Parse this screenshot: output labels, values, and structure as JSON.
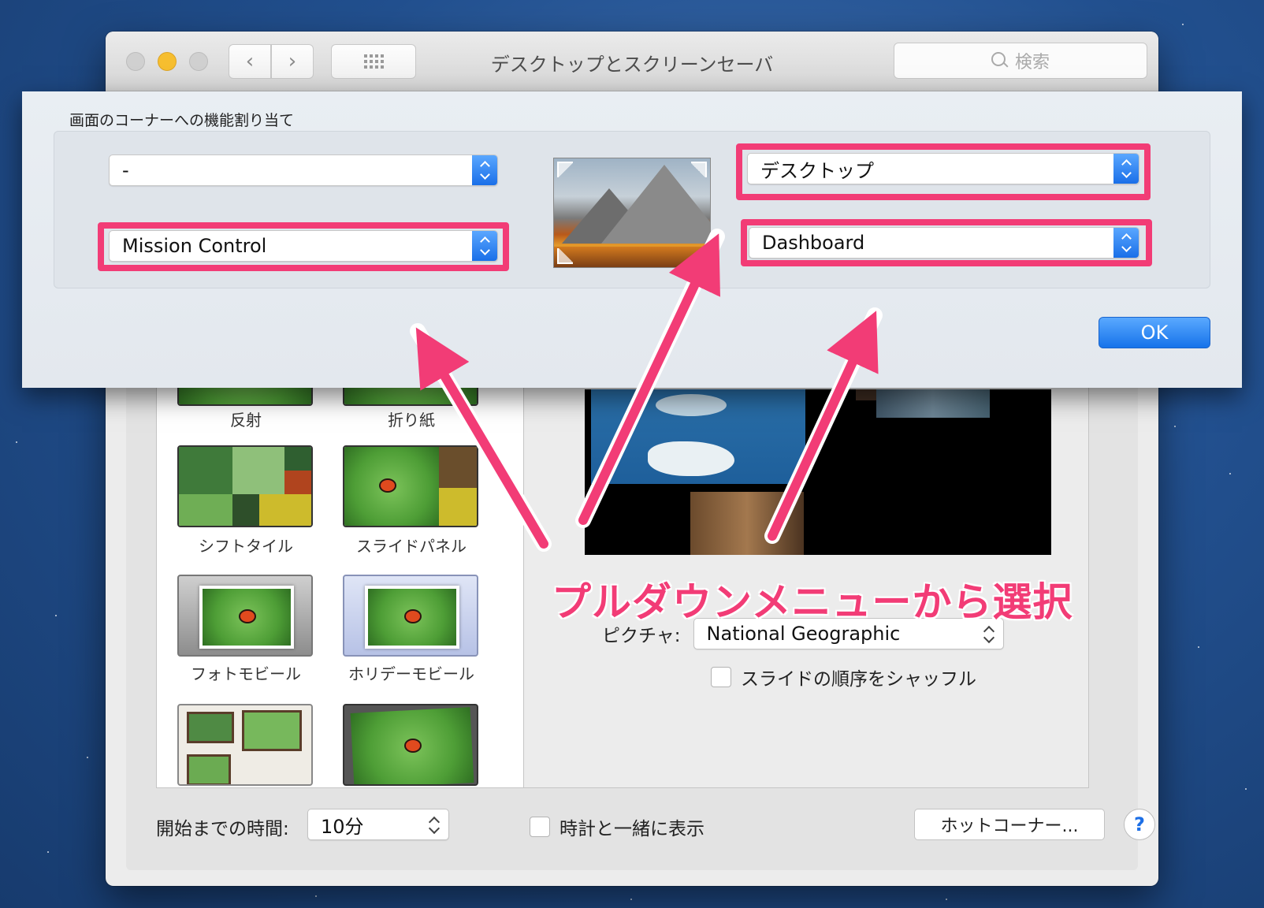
{
  "window": {
    "title": "デスクトップとスクリーンセーバ",
    "search_placeholder": "検索",
    "nav_back": "‹",
    "nav_forward": "›"
  },
  "screensavers": [
    {
      "label": "反射"
    },
    {
      "label": "折り紙"
    },
    {
      "label": "シフトタイル"
    },
    {
      "label": "スライドパネル"
    },
    {
      "label": "フォトモビール"
    },
    {
      "label": "ホリデーモビール"
    }
  ],
  "picture": {
    "label": "ピクチャ:",
    "value": "National Geographic"
  },
  "shuffle": {
    "label": "スライドの順序をシャッフル",
    "checked": false
  },
  "bottom": {
    "start_label": "開始までの時間:",
    "start_value": "10分",
    "clock_label": "時計と一緒に表示",
    "hot_corners_button": "ホットコーナー...",
    "help": "?"
  },
  "hot_corners_sheet": {
    "title": "画面のコーナーへの機能割り当て",
    "top_left": "-",
    "bottom_left": "Mission Control",
    "top_right": "デスクトップ",
    "bottom_right": "Dashboard",
    "ok": "OK"
  },
  "annotation": {
    "text": "プルダウンメニューから選択",
    "color": "#f23c76"
  },
  "colors": {
    "accent": "#1a6fe8",
    "highlight": "#f23c76"
  }
}
